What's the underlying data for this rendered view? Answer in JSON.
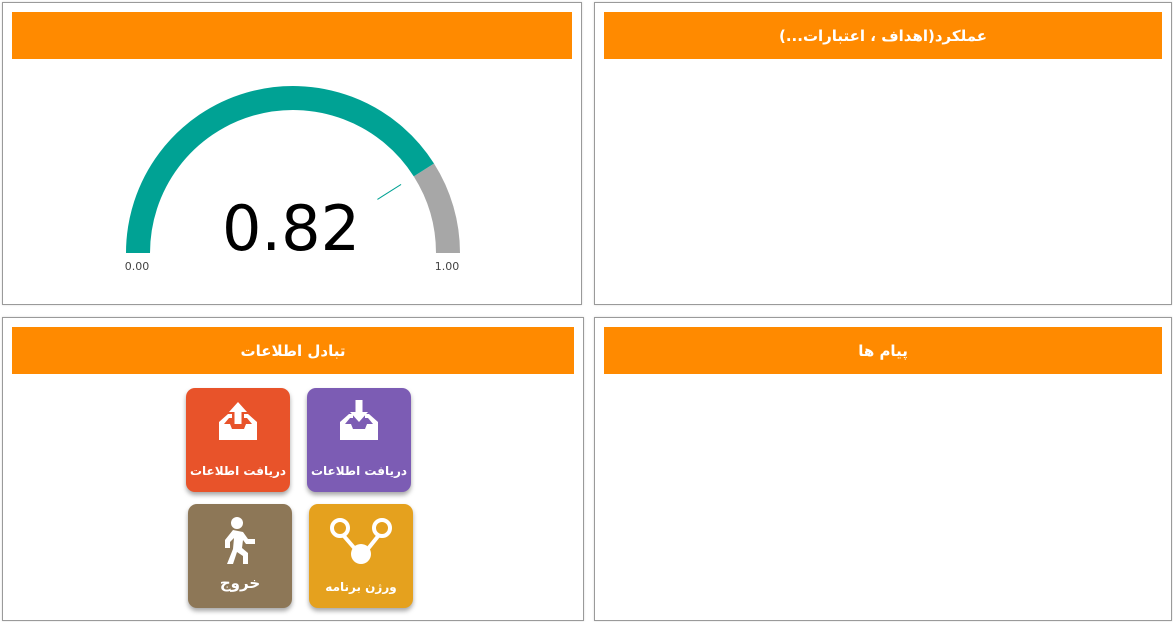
{
  "panels": {
    "gauge": {
      "title": ""
    },
    "performance": {
      "title": "عملکرد(اهداف ، اعتبارات...)"
    },
    "exchange": {
      "title": "تبادل اطلاعات"
    },
    "messages": {
      "title": "پیام ها"
    }
  },
  "gauge": {
    "value": 0.82,
    "value_text": "0.82",
    "min": 0,
    "max": 1,
    "min_label": "0.00",
    "max_label": "1.00",
    "fill_color": "#00a294",
    "rest_color": "#a7a7a7"
  },
  "tiles": [
    {
      "label": "دریافت اطلاعات",
      "icon": "inbox-upload-icon",
      "color": "#e8532a"
    },
    {
      "label": "دریافت اطلاعات",
      "icon": "inbox-download-icon",
      "color": "#7c5cb4"
    },
    {
      "label": "خروج",
      "icon": "exit-running-icon",
      "color": "#8d7757"
    },
    {
      "label": "ورژن برنامه",
      "icon": "version-branch-icon",
      "color": "#e5a11e"
    }
  ]
}
